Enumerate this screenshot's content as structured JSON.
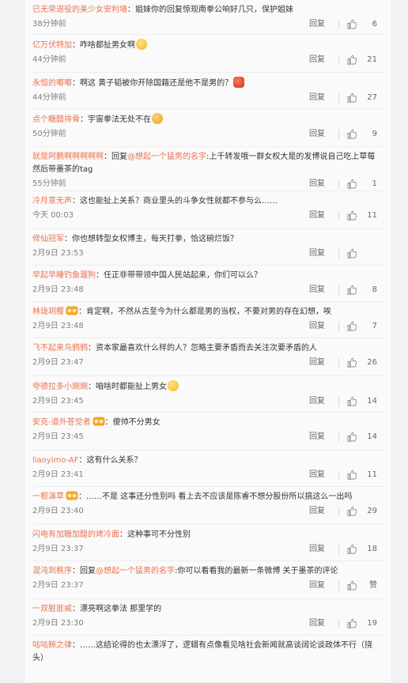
{
  "labels": {
    "reply": "回复",
    "like_zan": "赞"
  },
  "comments": [
    {
      "user": "已无荣退役的美少女安利墙",
      "text": "：姐妹你的回复惊现南拳公响好几只，保护姐妹",
      "time": "38分钟前",
      "likes": "6"
    },
    {
      "user": "亿万伏特加",
      "text": "：咋啥都扯男女啊",
      "time": "44分钟前",
      "likes": "21"
    },
    {
      "user": "永恒的嘟嘟",
      "text": "：啊这 黄子韬被你开除国籍还是他不是男的？",
      "time": "44分钟前",
      "likes": "27"
    },
    {
      "user": "点个糖醋排骨",
      "text": "：宇宙拳法无处不在",
      "time": "50分钟前",
      "likes": "9"
    },
    {
      "user": "就是阿鹏啊啊啊啊啊",
      "text_pre": "：回复",
      "mention": "@想起一个猛男的名字",
      "text": ":上千转发哦一群女权大是的发博说自己吃上草莓然后带墨茶的tag",
      "time": "55分钟前",
      "likes": "1"
    },
    {
      "user": "冷月意无声",
      "text": "：这也能扯上关系？商业里头的斗争女性就都不参与么……",
      "time": "今天 00:03",
      "likes": "11"
    },
    {
      "user": "修仙冠军",
      "text": "：你也想转型女权博主，每天打拳，恰这碗烂饭？",
      "time": "2月9日 23:53",
      "likes": ""
    },
    {
      "user": "早起早睡钓鱼遛狗",
      "text": "：任正非带带领中国人民站起来，你们可以么？",
      "time": "2月9日 23:48",
      "likes": "8"
    },
    {
      "user": "林珑玥樱",
      "text": "：肯定啊，不然从古至今为什么都是男的当权，不要对男的存在幻想，唉",
      "time": "2月9日 23:48",
      "likes": "7"
    },
    {
      "user": "飞不起来鸟鸦鸦",
      "text": "：资本家最喜欢什么样的人？忽略主要矛盾而去关注次要矛盾的人",
      "time": "2月9日 23:47",
      "likes": "26"
    },
    {
      "user": "夸德拉多小豌豌",
      "text": "：咱啥时都能扯上男女",
      "time": "2月9日 23:45",
      "likes": "14"
    },
    {
      "user": "安克-道外苍觉者",
      "text": "：傻帅不分男女",
      "time": "2月9日 23:45",
      "likes": "14"
    },
    {
      "user": "liaoyimo-AF",
      "text": "：这有什么关系？",
      "time": "2月9日 23:41",
      "likes": "11"
    },
    {
      "user": "一根演草",
      "text": "：……不是 这事还分性别吗 看上去不应该是陈睿不想分股份所以搞这么一出吗",
      "time": "2月9日 23:40",
      "likes": "29"
    },
    {
      "user": "闪电有加糖加醋的烤冷面",
      "text": "：这种事可不分性别",
      "time": "2月9日 23:37",
      "likes": "18"
    },
    {
      "user": "混沌到秩序",
      "text_pre": "：回复",
      "mention": "@想起一个猛男的名字",
      "text": ":你可以看看我的最新一条微博 关于墨茶的评论",
      "time": "2月9日 23:37",
      "likes": "赞"
    },
    {
      "user": "一双脏匪威",
      "text": "：漂亮啊这拳法 那里学的",
      "time": "2月9日 23:30",
      "likes": "19"
    },
    {
      "user": "咕咕鲸之律",
      "text": "：……这结论得的也太漂浮了，逻辑有点像看见啥社会新闻就高谈阔论谈政体不行（挠头）",
      "time": "",
      "likes": ""
    }
  ]
}
